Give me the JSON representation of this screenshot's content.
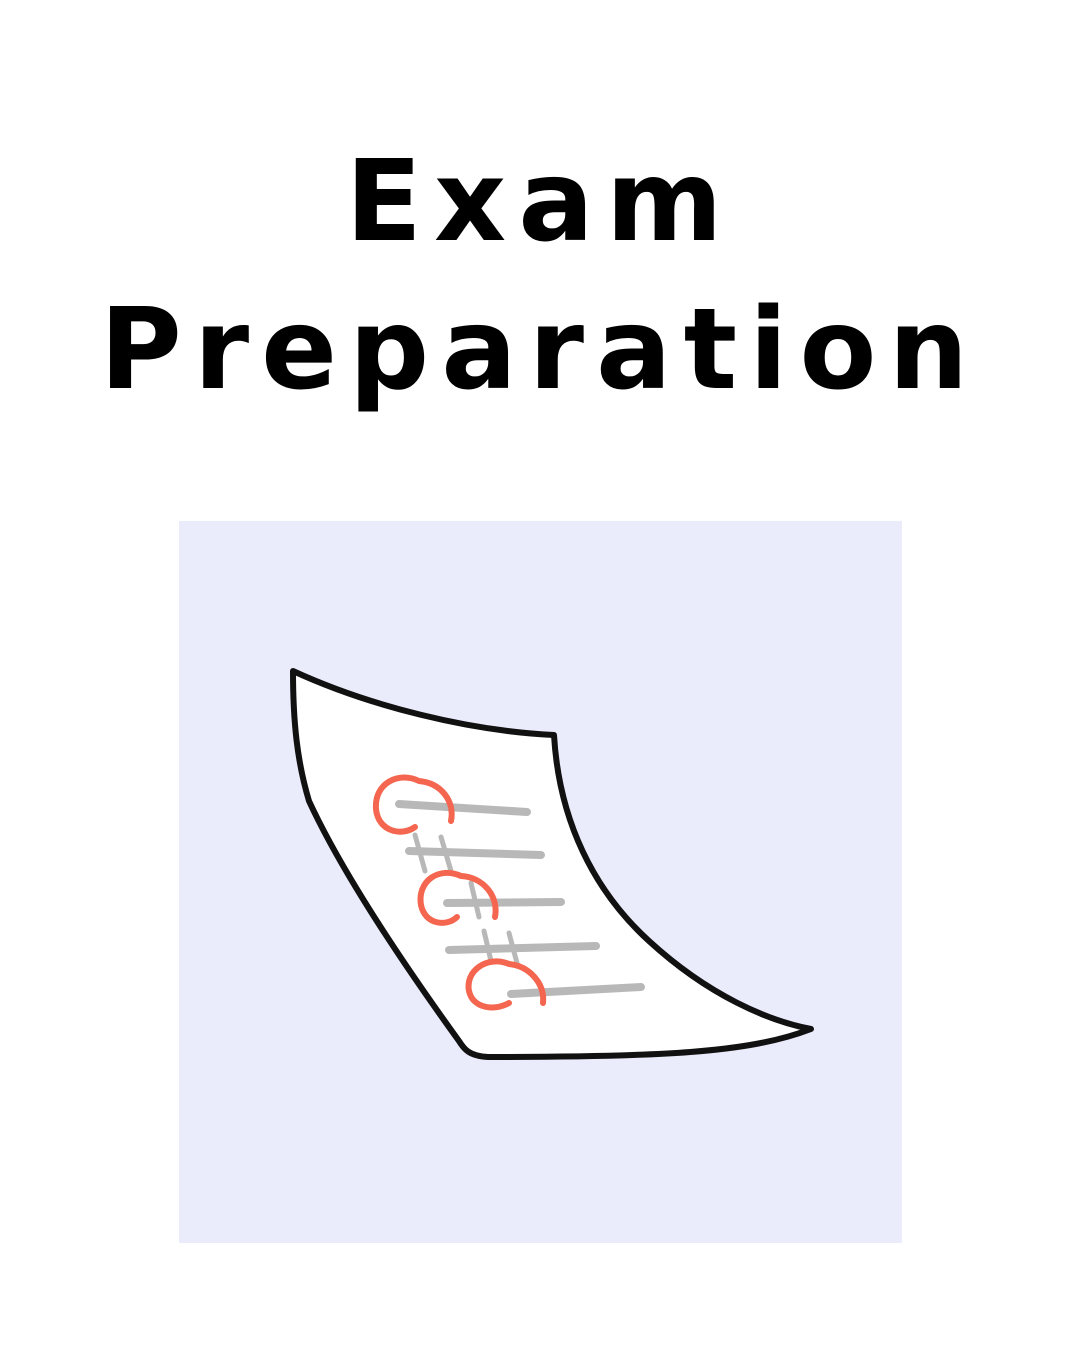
{
  "title": {
    "line1": "Exam",
    "line2": "Preparation"
  },
  "illustration": {
    "icon": "exam-paper-icon",
    "background_color": "#eaebfb",
    "mark_color": "#f4664f",
    "line_color": "#b8b8b8"
  }
}
